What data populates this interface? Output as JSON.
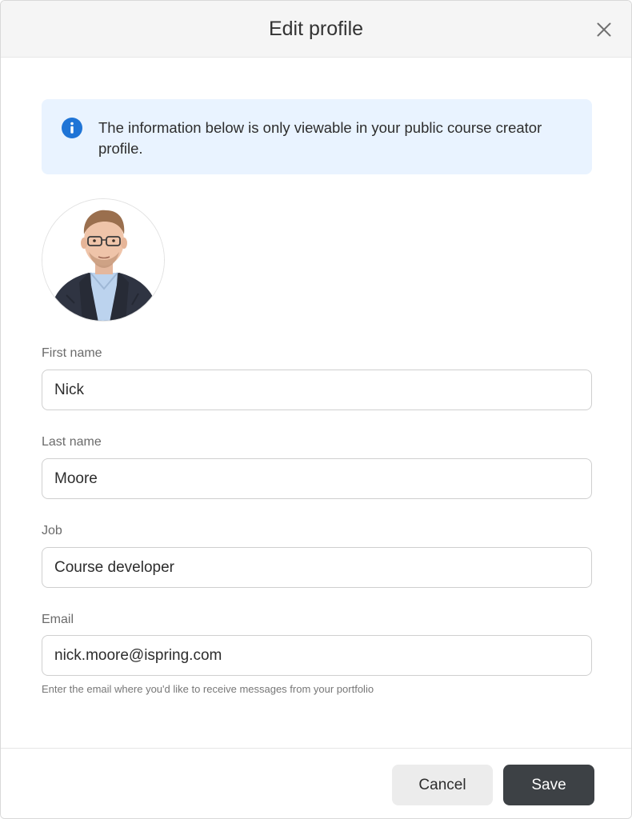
{
  "dialog": {
    "title": "Edit profile"
  },
  "info": {
    "text": "The information below is only viewable in your public course creator profile.",
    "icon": "info-icon",
    "accent": "#1f74d6"
  },
  "avatar": {
    "icon": "profile-photo"
  },
  "fields": {
    "first_name": {
      "label": "First name",
      "value": "Nick"
    },
    "last_name": {
      "label": "Last name",
      "value": "Moore"
    },
    "job": {
      "label": "Job",
      "value": "Course developer"
    },
    "email": {
      "label": "Email",
      "value": "nick.moore@ispring.com",
      "hint": "Enter the email where you'd like to receive messages from your portfolio"
    }
  },
  "footer": {
    "cancel_label": "Cancel",
    "save_label": "Save",
    "save_color": "#3d4145"
  }
}
